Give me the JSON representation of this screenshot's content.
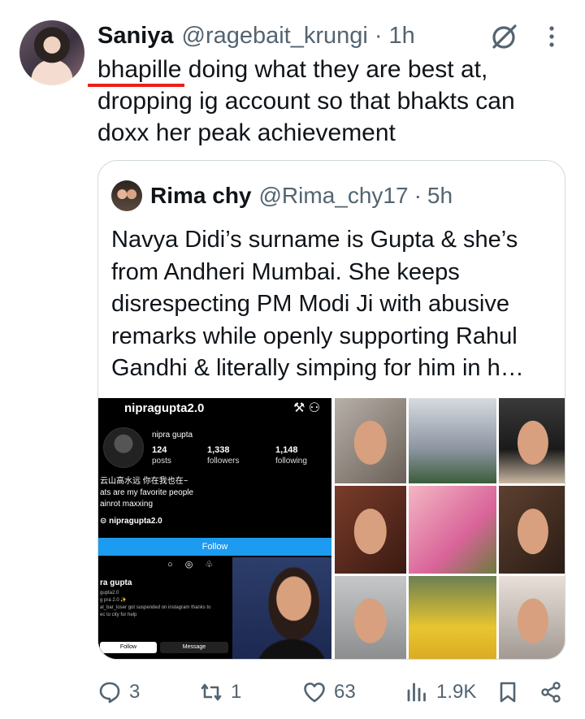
{
  "tweet": {
    "author_name": "Saniya",
    "author_handle": "@ragebait_krungi",
    "dot": "·",
    "time": "1h",
    "text_highlight": "bhapille",
    "text_rest": " doing what they are best at, dropping ig account so that bhakts can doxx her peak achievement",
    "highlight_color": "#e8211a"
  },
  "quote": {
    "author_name": "Rima chy",
    "author_handle": "@Rima_chy17",
    "dot": "·",
    "time": "5h",
    "text": "Navya Didi’s surname is Gupta & she’s from Andheri Mumbai. She keeps disrespecting PM Modi Ji with abusive remarks while openly supporting Rahul Gandhi & literally simping for him in h…"
  },
  "instagram": {
    "username": "nipragupta2.0",
    "display_name": "nipra gupta",
    "posts": "124",
    "posts_label": "posts",
    "followers": "1,338",
    "followers_label": "followers",
    "following": "1,148",
    "following_label": "following",
    "bio_line1": "云山高水远 你在我也在~",
    "bio_line2": "ats are my favorite people",
    "bio_line3": "ainrot maxxing",
    "link": "nipragupta2.0",
    "follow_label": "Follow",
    "profile2_name": "ra gupta",
    "profile2_handle": "gupta2.0",
    "profile2_line1": "g pra 2.0 ✨",
    "profile2_line2": "al_bar_loser got suspended on instagram thanks to",
    "profile2_line3": "ec to city for help",
    "profile2_follow": "Follow",
    "profile2_message": "Message"
  },
  "actions": {
    "replies": "3",
    "reposts": "1",
    "likes": "63",
    "views": "1.9K"
  },
  "colors": {
    "text_primary": "#0f1419",
    "text_secondary": "#536471",
    "border": "#cfd9de",
    "ig_follow": "#1d9bf0"
  }
}
